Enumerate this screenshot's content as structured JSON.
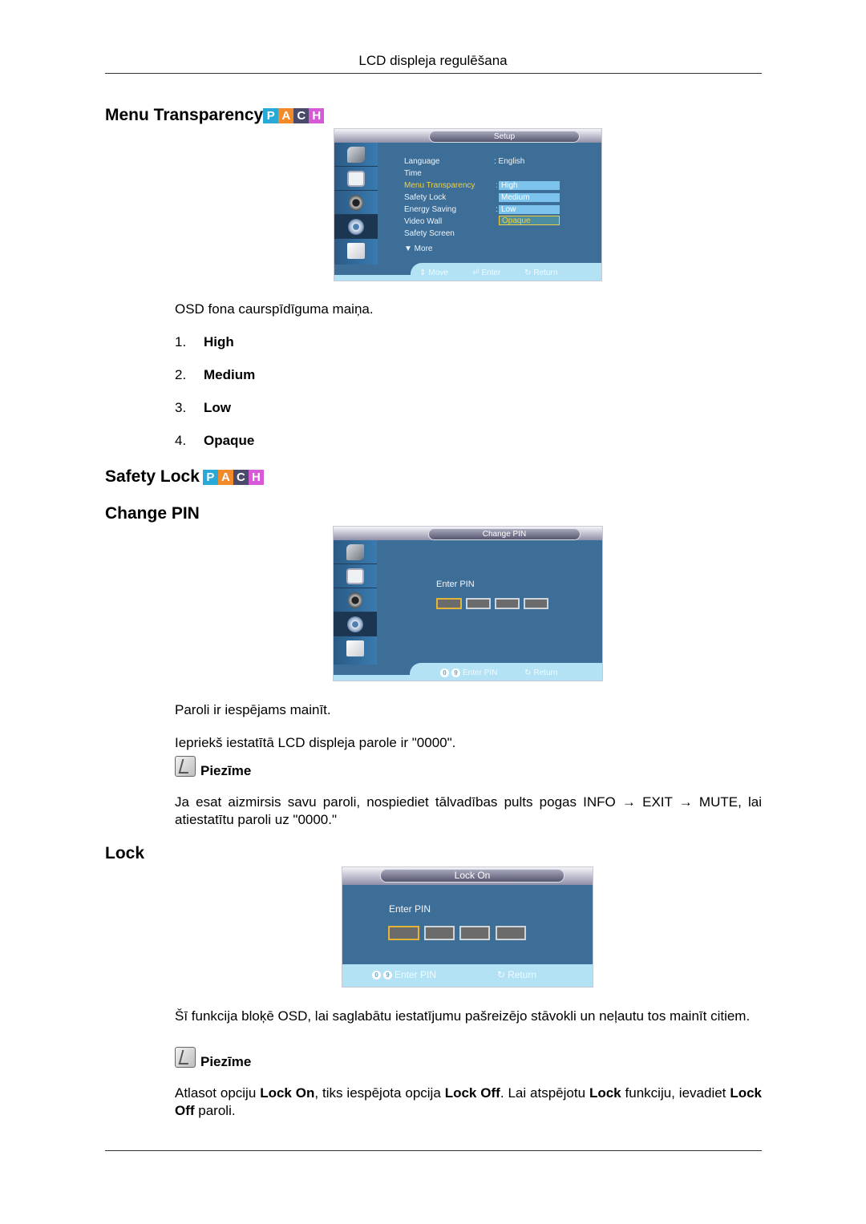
{
  "header": {
    "title": "LCD displeja regulēšana"
  },
  "badge_letters": [
    "P",
    "A",
    "C",
    "H"
  ],
  "sections": {
    "menu_transparency": {
      "title": "Menu Transparency",
      "osd": {
        "title": "Setup",
        "side_icons": [
          "input-icon",
          "picture-icon",
          "sound-icon",
          "setup-icon",
          "multi-control-icon"
        ],
        "menu": [
          {
            "label": "Language",
            "value": ": English"
          },
          {
            "label": "Time",
            "value": ""
          },
          {
            "label": "Menu Transparency",
            "value": ":"
          },
          {
            "label": "Safety Lock",
            "value": ""
          },
          {
            "label": "Energy Saving",
            "value": ":"
          },
          {
            "label": "Video Wall",
            "value": ""
          },
          {
            "label": "Safety Screen",
            "value": ""
          }
        ],
        "more": "▼ More",
        "dropdown": [
          "High",
          "Medium",
          "Low",
          "Opaque"
        ],
        "dropdown_selected": "Opaque",
        "footer": {
          "move": "Move",
          "enter": "Enter",
          "return": "Return"
        }
      },
      "description": "OSD fona caurspīdīguma maiņa.",
      "options": [
        {
          "num": "1.",
          "label": "High"
        },
        {
          "num": "2.",
          "label": "Medium"
        },
        {
          "num": "3.",
          "label": "Low"
        },
        {
          "num": "4.",
          "label": "Opaque"
        }
      ]
    },
    "safety_lock": {
      "title": "Safety Lock"
    },
    "change_pin": {
      "title": "Change PIN",
      "osd": {
        "title": "Change PIN",
        "enter_pin": "Enter PIN",
        "footer": {
          "digits_from": "0",
          "digits_to": "9",
          "enter": "Enter PIN",
          "return": "Return"
        }
      },
      "para1": "Paroli ir iespējams mainīt.",
      "para2": "Iepriekš iestatītā LCD displeja parole ir \"0000\".",
      "note_label": "Piezīme",
      "note_text": "Ja esat aizmirsis savu paroli, nospiediet tālvadības pults pogas INFO → EXIT → MUTE, lai atiestatītu paroli uz \"0000.\""
    },
    "lock": {
      "title": "Lock",
      "osd": {
        "title": "Lock On",
        "enter_pin": "Enter PIN",
        "footer": {
          "digits_from": "0",
          "digits_to": "9",
          "enter": "Enter PIN",
          "return": "Return"
        }
      },
      "para": "Šī funkcija bloķē OSD, lai saglabātu iestatījumu pašreizējo stāvokli un neļautu tos mainīt citiem.",
      "note_label": "Piezīme",
      "note_parts": [
        {
          "text": "Atlasot opciju ",
          "bold": false
        },
        {
          "text": "Lock On",
          "bold": true
        },
        {
          "text": ", tiks iespējota opcija ",
          "bold": false
        },
        {
          "text": "Lock Off",
          "bold": true
        },
        {
          "text": ". Lai atspējotu ",
          "bold": false
        },
        {
          "text": "Lock",
          "bold": true
        },
        {
          "text": " funkciju, ievadiet ",
          "bold": false
        },
        {
          "text": "Lock Off",
          "bold": true
        },
        {
          "text": " paroli.",
          "bold": false
        }
      ]
    }
  }
}
